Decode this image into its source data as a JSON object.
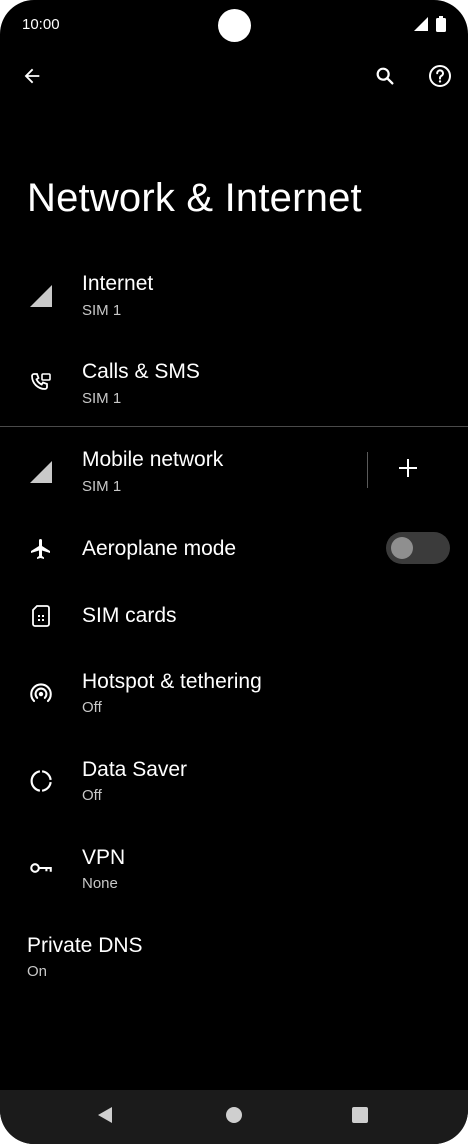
{
  "status_bar": {
    "time": "10:00"
  },
  "app_bar": {
    "back_icon": "arrow-back-icon",
    "search_icon": "search-icon",
    "help_icon": "help-icon"
  },
  "page": {
    "title": "Network & Internet"
  },
  "items": [
    {
      "key": "internet",
      "icon": "signal-icon",
      "label": "Internet",
      "subtitle": "SIM 1"
    },
    {
      "key": "calls-sms",
      "icon": "calls-sms-icon",
      "label": "Calls & SMS",
      "subtitle": "SIM 1"
    },
    {
      "key": "mobile-network",
      "icon": "signal-icon",
      "label": "Mobile network",
      "subtitle": "SIM 1"
    },
    {
      "key": "aeroplane-mode",
      "icon": "airplane-icon",
      "label": "Aeroplane mode",
      "toggle_on": false
    },
    {
      "key": "sim-cards",
      "icon": "sim-card-icon",
      "label": "SIM cards"
    },
    {
      "key": "hotspot",
      "icon": "hotspot-icon",
      "label": "Hotspot & tethering",
      "subtitle": "Off"
    },
    {
      "key": "data-saver",
      "icon": "data-saver-icon",
      "label": "Data Saver",
      "subtitle": "Off"
    },
    {
      "key": "vpn",
      "icon": "vpn-key-icon",
      "label": "VPN",
      "subtitle": "None"
    },
    {
      "key": "private-dns",
      "label": "Private DNS",
      "subtitle": "On"
    }
  ],
  "colors": {
    "background": "#000000",
    "text": "#ffffff",
    "subtext": "#c8c8c8",
    "divider": "#4a4a4a",
    "toggle_track": "#3b3b3b",
    "toggle_knob": "#8f8f8f",
    "nav_bar": "#1b1b1b"
  },
  "nav_bar": {
    "back_icon": "nav-back-icon",
    "home_icon": "nav-home-icon",
    "recents_icon": "nav-recents-icon"
  }
}
